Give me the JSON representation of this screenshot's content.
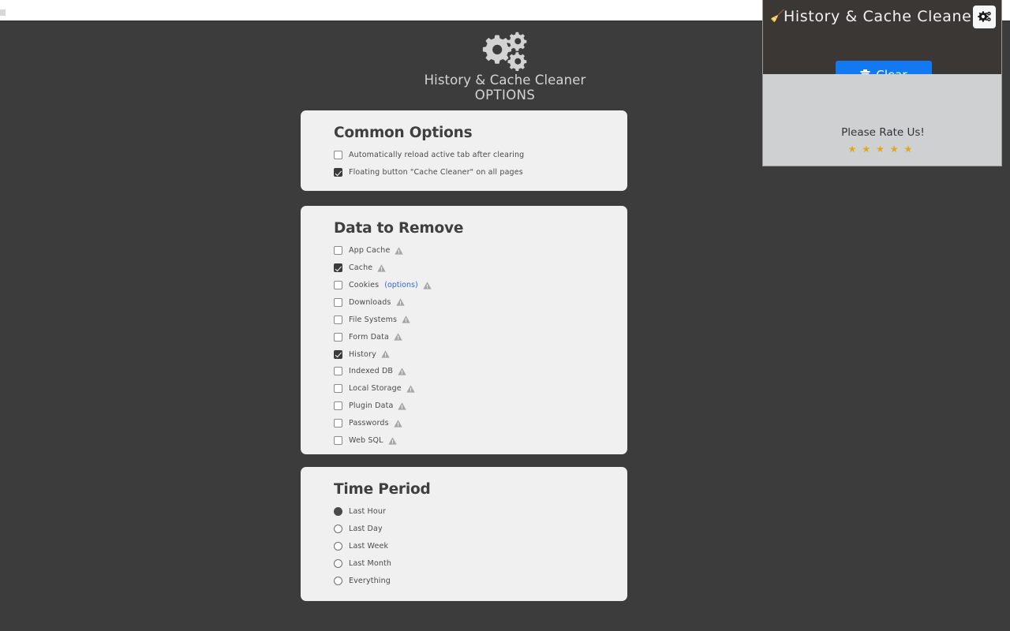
{
  "browser": {
    "strip_nub": "tab-nub"
  },
  "options_page": {
    "logo_icon": "gears-icon",
    "app_title": "History & Cache Cleaner",
    "subtitle": "OPTIONS",
    "background_color": "#3c3c3c",
    "card_color": "#f0f0f0",
    "link_color": "#3366dd"
  },
  "common_options": {
    "title": "Common Options",
    "items": [
      {
        "label": "Automatically reload active tab after clearing",
        "checked": false
      },
      {
        "label": "Floating button \"Cache Cleaner\" on all pages",
        "checked": true
      }
    ]
  },
  "data_to_remove": {
    "title": "Data to Remove",
    "items": [
      {
        "label": "App Cache",
        "checked": false,
        "warning": true,
        "link": null
      },
      {
        "label": "Cache",
        "checked": true,
        "warning": true,
        "link": null
      },
      {
        "label": "Cookies",
        "checked": false,
        "warning": true,
        "link": "(options)"
      },
      {
        "label": "Downloads",
        "checked": false,
        "warning": true,
        "link": null
      },
      {
        "label": "File Systems",
        "checked": false,
        "warning": true,
        "link": null
      },
      {
        "label": "Form Data",
        "checked": false,
        "warning": true,
        "link": null
      },
      {
        "label": "History",
        "checked": true,
        "warning": true,
        "link": null
      },
      {
        "label": "Indexed DB",
        "checked": false,
        "warning": true,
        "link": null
      },
      {
        "label": "Local Storage",
        "checked": false,
        "warning": true,
        "link": null
      },
      {
        "label": "Plugin Data",
        "checked": false,
        "warning": true,
        "link": null
      },
      {
        "label": "Passwords",
        "checked": false,
        "warning": true,
        "link": null
      },
      {
        "label": "Web SQL",
        "checked": false,
        "warning": true,
        "link": null
      }
    ]
  },
  "time_period": {
    "title": "Time Period",
    "selected": "Last Hour",
    "items": [
      {
        "label": "Last Hour",
        "selected": true
      },
      {
        "label": "Last Day",
        "selected": false
      },
      {
        "label": "Last Week",
        "selected": false
      },
      {
        "label": "Last Month",
        "selected": false
      },
      {
        "label": "Everything",
        "selected": false
      }
    ]
  },
  "popup": {
    "broom_icon": "broom-icon",
    "title": "History & Cache Cleaner",
    "settings_icon": "gear-settings-icon",
    "clear_button": {
      "label": "Clear",
      "icon": "trash-icon",
      "color": "#1279f2"
    },
    "rate_text": "Please Rate Us!",
    "stars": 5,
    "star_color": "#e8a317"
  }
}
